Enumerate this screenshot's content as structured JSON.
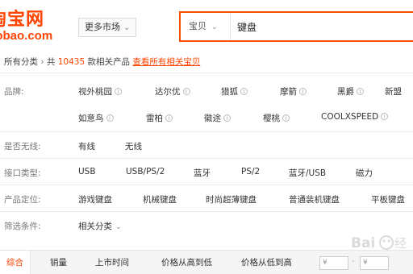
{
  "logo": {
    "top": "淘宝网",
    "bottom": "aobao.com"
  },
  "market_button": {
    "label": "更多市场",
    "chevron": "chevron-down-icon"
  },
  "search": {
    "category": "宝贝",
    "value": "键盘"
  },
  "breadcrumb": {
    "root": "所有分类",
    "sep": "›",
    "prefix": "共",
    "count": "10435",
    "suffix": "款相关产品",
    "link": "查看所有相关宝贝"
  },
  "filters": {
    "brand": {
      "label": "品牌:",
      "items": [
        "视外桃园",
        "达尔优",
        "猎狐",
        "摩箭",
        "黑爵",
        "新盟",
        "如意鸟",
        "雷柏",
        "徽途",
        "樱桃",
        "COOLXSPEED"
      ]
    },
    "wireless": {
      "label": "是否无线:",
      "items": [
        "有线",
        "无线"
      ]
    },
    "interface": {
      "label": "接口类型:",
      "items": [
        "USB",
        "USB/PS/2",
        "蓝牙",
        "PS/2",
        "蓝牙/USB",
        "磁力"
      ]
    },
    "position": {
      "label": "产品定位:",
      "items": [
        "游戏键盘",
        "机械键盘",
        "时尚超薄键盘",
        "普通装机键盘",
        "平板键盘"
      ]
    },
    "conditions": {
      "label": "筛选条件:",
      "items": [
        "相关分类"
      ]
    }
  },
  "sortbar": {
    "items": [
      "综合",
      "销量",
      "上市时间",
      "价格从高到低",
      "价格从低到高"
    ],
    "active_index": 0,
    "price_placeholder": "¥",
    "price_dash": "-"
  },
  "colors": {
    "accent": "#ff4400",
    "search_border": "#ff5000"
  }
}
